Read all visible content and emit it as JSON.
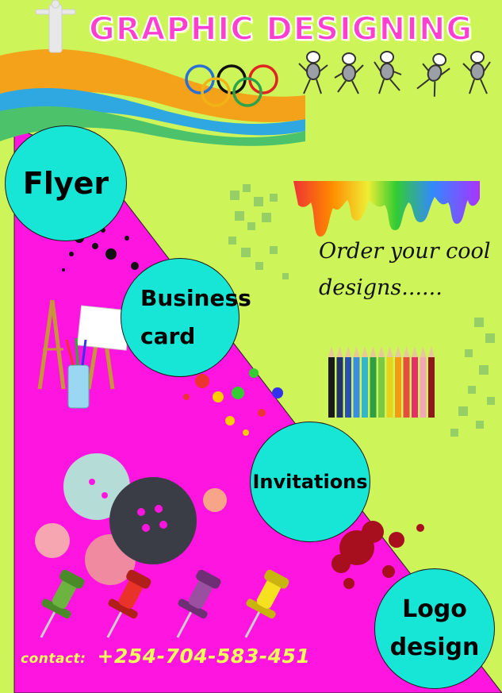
{
  "flyer": {
    "title": "GRAPHIC DESIGNING",
    "tagline_line1": "Order your cool",
    "tagline_line2": "designs......",
    "services": {
      "flyer": "Flyer",
      "business_card_line1": "Business",
      "business_card_line2": "card",
      "invitations": "Invitations",
      "logo_line1": "Logo",
      "logo_line2": "design"
    },
    "contact_label": "contact:",
    "contact_phone": "+254-704-583-451"
  },
  "colors": {
    "background": "#cdf55a",
    "panel": "#ff14e0",
    "circle": "#17e6d6",
    "title": "#ff3fd0",
    "contact": "#f4ff5a"
  },
  "icons": [
    "olympic-rings-icon",
    "stick-figures-icon",
    "paint-drip-icon",
    "colored-pencils-icon",
    "easel-icon",
    "buttons-icon",
    "push-pins-icon",
    "ink-splatter-icon"
  ]
}
